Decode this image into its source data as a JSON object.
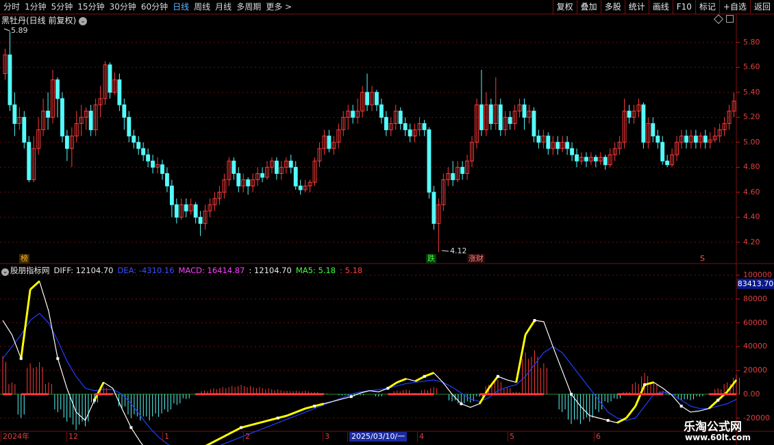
{
  "toolbar": {
    "periods": [
      "分时",
      "1分钟",
      "5分钟",
      "15分钟",
      "30分钟",
      "60分钟",
      "日线",
      "周线",
      "月线",
      "多周期",
      "更多 >"
    ],
    "active_period": "日线",
    "tools": [
      "复权",
      "叠加",
      "多股",
      "统计",
      "画线",
      "F10",
      "标记",
      "+自选",
      "返回"
    ]
  },
  "main_panel": {
    "title": "黑牡丹(日线 前复权)",
    "max_label": "5.89",
    "min_label": "4.12",
    "y_ticks": [
      "5.80",
      "5.60",
      "5.40",
      "5.20",
      "5.00",
      "4.80",
      "4.60",
      "4.40",
      "4.20"
    ],
    "tags": {
      "bang": "榜",
      "die": "跌",
      "zhangcai": "涨财",
      "s": "S"
    }
  },
  "indicator_panel": {
    "name": "股朋指标网",
    "legend": {
      "diff": "DIFF: 12104.70",
      "dea": "DEA: -4310.16",
      "macd": "MACD: 16414.87",
      "blank": ": 12104.70",
      "ma5": "MA5: 5.18",
      "last": ": 5.18"
    },
    "y_ticks": [
      "100000",
      "80000",
      "60000",
      "40000",
      "20000",
      "0.00",
      "-20000"
    ],
    "current_value": "83413.70"
  },
  "x_axis": {
    "labels": [
      "2024年",
      "12",
      "1",
      "2",
      "3",
      "2025/03/10/一",
      "4",
      "5",
      "6"
    ]
  },
  "watermark": {
    "title": "乐淘公式网",
    "url": "www.60lt.com"
  },
  "colors": {
    "up": "#ff3b3b",
    "down": "#54fcfc",
    "diff": "#ffffff",
    "dea": "#2040ff",
    "highlight": "#ffff00",
    "grid": "#7a1010"
  },
  "chart_data": {
    "type": "candlestick",
    "price_range": [
      4.12,
      5.89
    ],
    "candles": [
      [
        5.55,
        5.7,
        5.75,
        5.5
      ],
      [
        5.7,
        5.3,
        5.89,
        5.25
      ],
      [
        5.3,
        5.15,
        5.4,
        5.05
      ],
      [
        5.15,
        5.2,
        5.28,
        5.1
      ],
      [
        5.2,
        5.0,
        5.25,
        4.95
      ],
      [
        5.0,
        4.7,
        5.05,
        4.68
      ],
      [
        4.7,
        4.95,
        5.05,
        4.68
      ],
      [
        4.95,
        5.1,
        5.2,
        4.9
      ],
      [
        5.1,
        5.25,
        5.35,
        5.05
      ],
      [
        5.25,
        5.2,
        5.4,
        5.1
      ],
      [
        5.2,
        5.5,
        5.58,
        5.15
      ],
      [
        5.5,
        5.35,
        5.52,
        5.2
      ],
      [
        5.35,
        5.05,
        5.4,
        5.0
      ],
      [
        5.05,
        4.95,
        5.1,
        4.85
      ],
      [
        4.95,
        5.05,
        5.12,
        4.8
      ],
      [
        5.05,
        5.15,
        5.25,
        5.0
      ],
      [
        5.15,
        5.2,
        5.3,
        5.05
      ],
      [
        5.2,
        5.25,
        5.28,
        5.1
      ],
      [
        5.25,
        5.1,
        5.3,
        5.05
      ],
      [
        5.1,
        5.3,
        5.35,
        5.05
      ],
      [
        5.3,
        5.35,
        5.45,
        5.2
      ],
      [
        5.35,
        5.62,
        5.65,
        5.3
      ],
      [
        5.62,
        5.4,
        5.64,
        5.35
      ],
      [
        5.4,
        5.5,
        5.56,
        5.38
      ],
      [
        5.5,
        5.3,
        5.55,
        5.25
      ],
      [
        5.3,
        5.2,
        5.35,
        5.1
      ],
      [
        5.2,
        5.05,
        5.25,
        5.0
      ],
      [
        5.05,
        5.0,
        5.1,
        4.95
      ],
      [
        5.0,
        4.95,
        5.05,
        4.9
      ],
      [
        4.95,
        4.9,
        5.0,
        4.85
      ],
      [
        4.9,
        4.85,
        4.95,
        4.8
      ],
      [
        4.85,
        4.8,
        4.9,
        4.75
      ],
      [
        4.8,
        4.82,
        4.88,
        4.75
      ],
      [
        4.82,
        4.75,
        4.86,
        4.7
      ],
      [
        4.75,
        4.65,
        4.8,
        4.6
      ],
      [
        4.65,
        4.5,
        4.7,
        4.4
      ],
      [
        4.5,
        4.4,
        4.55,
        4.35
      ],
      [
        4.4,
        4.5,
        4.55,
        4.38
      ],
      [
        4.5,
        4.45,
        4.55,
        4.4
      ],
      [
        4.45,
        4.5,
        4.55,
        4.42
      ],
      [
        4.5,
        4.4,
        4.52,
        4.35
      ],
      [
        4.4,
        4.35,
        4.45,
        4.25
      ],
      [
        4.35,
        4.45,
        4.5,
        4.3
      ],
      [
        4.45,
        4.5,
        4.55,
        4.4
      ],
      [
        4.5,
        4.55,
        4.6,
        4.45
      ],
      [
        4.55,
        4.6,
        4.65,
        4.5
      ],
      [
        4.6,
        4.7,
        4.75,
        4.55
      ],
      [
        4.7,
        4.85,
        4.88,
        4.65
      ],
      [
        4.85,
        4.75,
        4.88,
        4.7
      ],
      [
        4.75,
        4.65,
        4.8,
        4.6
      ],
      [
        4.65,
        4.7,
        4.75,
        4.6
      ],
      [
        4.7,
        4.65,
        4.72,
        4.58
      ],
      [
        4.65,
        4.7,
        4.75,
        4.6
      ],
      [
        4.7,
        4.75,
        4.8,
        4.65
      ],
      [
        4.75,
        4.72,
        4.8,
        4.68
      ],
      [
        4.72,
        4.8,
        4.85,
        4.7
      ],
      [
        4.8,
        4.85,
        4.88,
        4.75
      ],
      [
        4.85,
        4.75,
        4.88,
        4.7
      ],
      [
        4.75,
        4.8,
        4.85,
        4.7
      ],
      [
        4.8,
        4.85,
        4.88,
        4.75
      ],
      [
        4.85,
        4.8,
        4.9,
        4.75
      ],
      [
        4.8,
        4.65,
        4.85,
        4.62
      ],
      [
        4.65,
        4.62,
        4.7,
        4.58
      ],
      [
        4.62,
        4.65,
        4.7,
        4.6
      ],
      [
        4.65,
        4.68,
        4.7,
        4.6
      ],
      [
        4.68,
        4.85,
        4.88,
        4.65
      ],
      [
        4.85,
        4.95,
        5.0,
        4.8
      ],
      [
        4.95,
        5.05,
        5.1,
        4.9
      ],
      [
        5.05,
        4.95,
        5.1,
        4.92
      ],
      [
        4.95,
        5.0,
        5.05,
        4.9
      ],
      [
        5.0,
        5.1,
        5.15,
        4.95
      ],
      [
        5.1,
        5.2,
        5.25,
        5.05
      ],
      [
        5.2,
        5.25,
        5.3,
        5.1
      ],
      [
        5.25,
        5.2,
        5.3,
        5.15
      ],
      [
        5.2,
        5.25,
        5.35,
        5.15
      ],
      [
        5.25,
        5.4,
        5.45,
        5.2
      ],
      [
        5.4,
        5.3,
        5.55,
        5.25
      ],
      [
        5.3,
        5.4,
        5.45,
        5.25
      ],
      [
        5.4,
        5.3,
        5.42,
        5.25
      ],
      [
        5.3,
        5.2,
        5.35,
        5.15
      ],
      [
        5.2,
        5.1,
        5.25,
        5.05
      ],
      [
        5.1,
        5.15,
        5.2,
        5.05
      ],
      [
        5.15,
        5.25,
        5.3,
        5.1
      ],
      [
        5.25,
        5.15,
        5.28,
        5.1
      ],
      [
        5.15,
        5.1,
        5.2,
        5.05
      ],
      [
        5.1,
        5.05,
        5.15,
        5.0
      ],
      [
        5.05,
        5.1,
        5.15,
        5.0
      ],
      [
        5.1,
        5.15,
        5.2,
        5.05
      ],
      [
        5.15,
        5.1,
        5.18,
        5.05
      ],
      [
        5.1,
        4.6,
        5.12,
        4.55
      ],
      [
        4.6,
        4.35,
        4.65,
        4.3
      ],
      [
        4.35,
        4.5,
        4.55,
        4.12
      ],
      [
        4.5,
        4.7,
        4.75,
        4.45
      ],
      [
        4.7,
        4.75,
        4.8,
        4.65
      ],
      [
        4.75,
        4.7,
        4.85,
        4.65
      ],
      [
        4.7,
        4.8,
        4.85,
        4.68
      ],
      [
        4.8,
        4.75,
        4.85,
        4.7
      ],
      [
        4.75,
        4.85,
        4.9,
        4.7
      ],
      [
        4.85,
        5.0,
        5.05,
        4.8
      ],
      [
        5.0,
        5.3,
        5.35,
        4.95
      ],
      [
        5.3,
        5.1,
        5.58,
        5.05
      ],
      [
        5.1,
        5.3,
        5.4,
        5.05
      ],
      [
        5.3,
        5.15,
        5.35,
        5.1
      ],
      [
        5.15,
        5.3,
        5.52,
        5.1
      ],
      [
        5.3,
        5.1,
        5.35,
        5.05
      ],
      [
        5.1,
        5.2,
        5.25,
        5.05
      ],
      [
        5.2,
        5.15,
        5.25,
        5.1
      ],
      [
        5.15,
        5.25,
        5.3,
        5.1
      ],
      [
        5.25,
        5.3,
        5.35,
        5.2
      ],
      [
        5.3,
        5.2,
        5.35,
        5.1
      ],
      [
        5.2,
        5.25,
        5.3,
        5.15
      ],
      [
        5.25,
        5.05,
        5.28,
        5.0
      ],
      [
        5.05,
        5.0,
        5.1,
        4.95
      ],
      [
        5.0,
        5.05,
        5.1,
        4.95
      ],
      [
        5.05,
        4.95,
        5.08,
        4.9
      ],
      [
        4.95,
        5.0,
        5.05,
        4.9
      ],
      [
        5.0,
        4.95,
        5.05,
        4.9
      ],
      [
        4.95,
        5.0,
        5.05,
        4.92
      ],
      [
        5.0,
        4.95,
        5.05,
        4.9
      ],
      [
        4.95,
        4.9,
        5.0,
        4.85
      ],
      [
        4.9,
        4.85,
        4.95,
        4.8
      ],
      [
        4.85,
        4.88,
        4.92,
        4.82
      ],
      [
        4.88,
        4.85,
        4.92,
        4.8
      ],
      [
        4.85,
        4.88,
        4.92,
        4.82
      ],
      [
        4.88,
        4.85,
        4.9,
        4.8
      ],
      [
        4.85,
        4.88,
        4.92,
        4.82
      ],
      [
        4.88,
        4.82,
        4.9,
        4.78
      ],
      [
        4.82,
        4.9,
        4.95,
        4.8
      ],
      [
        4.9,
        4.95,
        5.0,
        4.85
      ],
      [
        4.95,
        5.0,
        5.05,
        4.9
      ],
      [
        5.0,
        5.25,
        5.35,
        4.95
      ],
      [
        5.25,
        5.2,
        5.3,
        5.15
      ],
      [
        5.2,
        5.25,
        5.3,
        5.15
      ],
      [
        5.25,
        5.3,
        5.35,
        5.2
      ],
      [
        5.3,
        5.0,
        5.32,
        4.95
      ],
      [
        5.0,
        5.15,
        5.2,
        4.95
      ],
      [
        5.15,
        5.05,
        5.2,
        5.0
      ],
      [
        5.05,
        5.0,
        5.1,
        4.95
      ],
      [
        5.0,
        4.85,
        5.05,
        4.82
      ],
      [
        4.85,
        4.82,
        4.9,
        4.8
      ],
      [
        4.82,
        4.9,
        4.95,
        4.8
      ],
      [
        4.9,
        5.0,
        5.05,
        4.85
      ],
      [
        5.0,
        5.05,
        5.1,
        4.95
      ],
      [
        5.05,
        5.0,
        5.1,
        4.95
      ],
      [
        5.0,
        5.05,
        5.1,
        4.95
      ],
      [
        5.05,
        5.0,
        5.1,
        4.95
      ],
      [
        5.0,
        5.05,
        5.08,
        4.95
      ],
      [
        5.05,
        5.0,
        5.1,
        4.95
      ],
      [
        5.0,
        5.02,
        5.08,
        4.95
      ],
      [
        5.02,
        5.05,
        5.12,
        5.0
      ],
      [
        5.05,
        5.1,
        5.15,
        5.0
      ],
      [
        5.1,
        5.15,
        5.2,
        5.05
      ],
      [
        5.15,
        5.25,
        5.3,
        5.1
      ],
      [
        5.25,
        5.33,
        5.4,
        5.2
      ]
    ],
    "indicator": {
      "ylim": [
        -30000,
        100000
      ],
      "diff": [
        62000,
        50000,
        30000,
        88000,
        95000,
        70000,
        30000,
        5000,
        -15000,
        -22000,
        -5000,
        10000,
        5000,
        -12000,
        -28000,
        -40000,
        -50000,
        -55000,
        -57000,
        -55000,
        -52000,
        -48000,
        -44000,
        -40000,
        -36000,
        -32000,
        -28000,
        -26000,
        -24000,
        -22000,
        -20000,
        -18000,
        -15000,
        -12000,
        -10000,
        -8000,
        -6000,
        -4000,
        -2000,
        1000,
        3000,
        2000,
        5000,
        10000,
        13000,
        11000,
        15000,
        18000,
        10000,
        0,
        -8000,
        -11000,
        -8000,
        5000,
        15000,
        12000,
        10000,
        50000,
        62000,
        61000,
        40000,
        20000,
        0,
        -10000,
        -18000,
        -20000,
        -22000,
        -24000,
        -20000,
        -10000,
        8000,
        10000,
        5000,
        -1000,
        -10000,
        -15000,
        -14000,
        -12000,
        -5000,
        2000,
        12000
      ],
      "dea": [
        30000,
        40000,
        50000,
        62000,
        68000,
        60000,
        45000,
        28000,
        15000,
        5000,
        3000,
        4000,
        4000,
        0,
        -8000,
        -18000,
        -28000,
        -36000,
        -42000,
        -46000,
        -48000,
        -48000,
        -47000,
        -45000,
        -42000,
        -39000,
        -36000,
        -33000,
        -30000,
        -27000,
        -24000,
        -21000,
        -18000,
        -15000,
        -12000,
        -9000,
        -6000,
        -3000,
        0,
        2000,
        3000,
        4000,
        5000,
        7000,
        9000,
        10000,
        11000,
        12000,
        10000,
        6000,
        1000,
        -4000,
        -6000,
        -3000,
        3000,
        6000,
        8000,
        15000,
        25000,
        35000,
        40000,
        35000,
        25000,
        15000,
        5000,
        -5000,
        -15000,
        -20000,
        -22000,
        -20000,
        -10000,
        0,
        2000,
        0,
        -5000,
        -10000,
        -12000,
        -12000,
        -10000,
        -8000,
        -4310
      ]
    }
  }
}
